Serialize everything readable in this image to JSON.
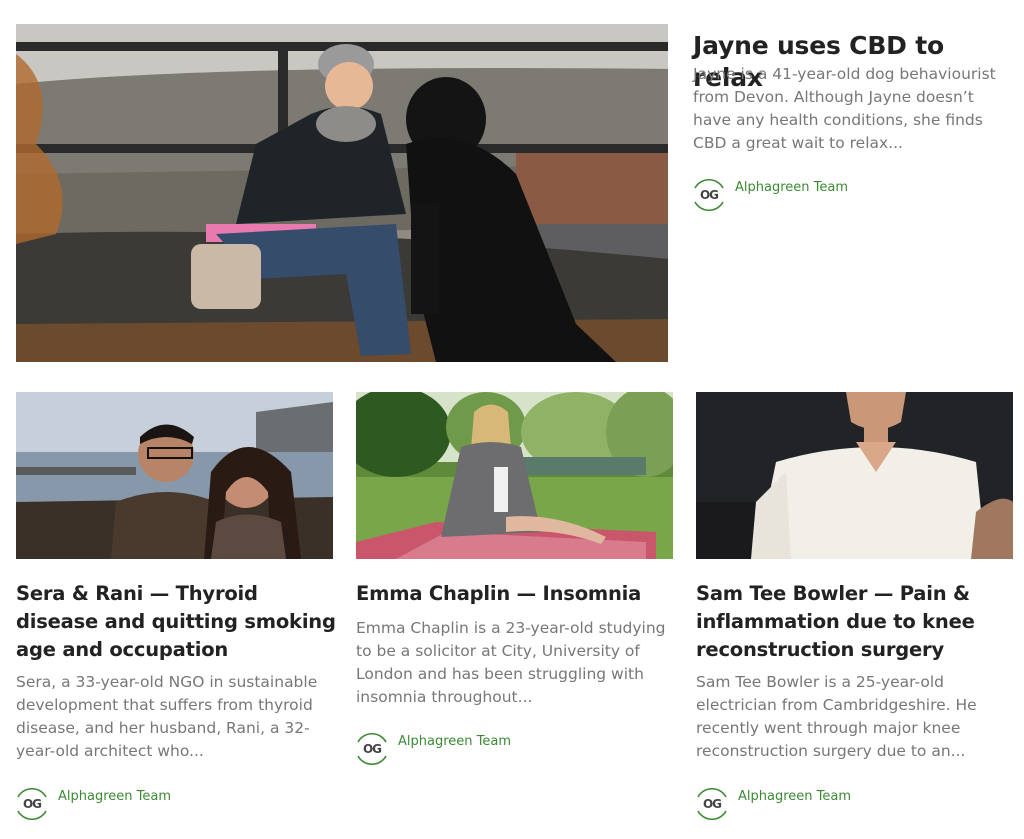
{
  "featured": {
    "title": "Jayne uses CBD to relax",
    "excerpt": "Jayne is a 41-year-old dog behaviourist from Devon. Although Jayne doesn’t have any health conditions, she finds CBD a great wait to relax...",
    "author": "Alphagreen Team",
    "logo_text": "OG"
  },
  "cards": [
    {
      "title": "Sera & Rani — Thyroid disease and quitting smoking age and occupation",
      "excerpt": "Sera, a 33-year-old NGO in sustainable development that suffers from thyroid disease, and her husband, Rani, a 32-year-old architect who...",
      "author": "Alphagreen Team",
      "logo_text": "OG"
    },
    {
      "title": "Emma Chaplin — Insomnia",
      "excerpt": "Emma Chaplin is a 23-year-old studying to be a solicitor at City, University of London and has been struggling with insomnia throughout...",
      "author": "Alphagreen Team",
      "logo_text": "OG"
    },
    {
      "title": "Sam Tee Bowler — Pain & inflammation due to knee reconstruction surgery",
      "excerpt": "Sam Tee Bowler is a 25-year-old electrician from Cambridgeshire. He recently went through major knee reconstruction surgery due to an...",
      "author": "Alphagreen Team",
      "logo_text": "OG"
    }
  ],
  "colors": {
    "brand_green": "#3c8a34",
    "title": "#222222",
    "excerpt": "#777777"
  }
}
